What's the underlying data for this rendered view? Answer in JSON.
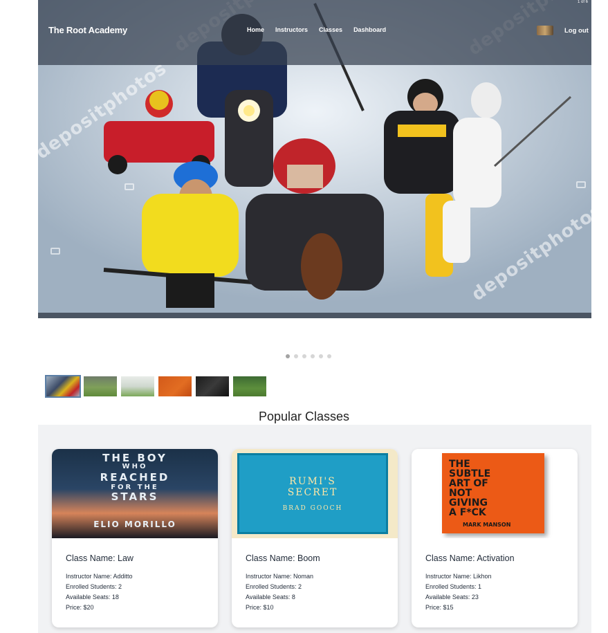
{
  "nav": {
    "brand": "The Root Academy",
    "links": [
      "Home",
      "Instructors",
      "Classes",
      "Dashboard"
    ],
    "logout": "Log out",
    "page_indicator": "1 of 6"
  },
  "hero": {
    "watermarks": [
      "depositphotos",
      "depositphotos",
      "depositphotos",
      "depositphotos"
    ]
  },
  "carousel": {
    "dot_count": 6,
    "active_index": 0,
    "thumbnails": 6
  },
  "section_title": "Popular Classes",
  "classes": [
    {
      "name_label": "Class Name: Law",
      "instructor": "Instructor Name: Additto",
      "enrolled": "Enrolled Students: 2",
      "seats": "Available Seats: 18",
      "price": "Price: $20",
      "cover": {
        "line1": "THE BOY",
        "line2": "WHO",
        "line3": "REACHED",
        "line4": "FOR THE",
        "line5": "STARS",
        "author": "ELIO MORILLO"
      }
    },
    {
      "name_label": "Class Name: Boom",
      "instructor": "Instructor Name: Noman",
      "enrolled": "Enrolled Students: 2",
      "seats": "Available Seats: 8",
      "price": "Price: $10",
      "cover": {
        "line1": "RUMI'S",
        "line2": "SECRET",
        "author": "BRAD GOOCH"
      }
    },
    {
      "name_label": "Class Name: Activation",
      "instructor": "Instructor Name: Likhon",
      "enrolled": "Enrolled Students: 1",
      "seats": "Available Seats: 23",
      "price": "Price: $15",
      "cover": {
        "line1": "THE",
        "line2": "SUBTLE",
        "line3": "ART OF",
        "line4": "NOT",
        "line5": "GIVING",
        "line6": "A F*CK",
        "author": "MARK MANSON"
      }
    }
  ],
  "colors": {
    "navbar": "#374151",
    "section_bg": "#f1f2f4",
    "active_thumb_outline": "#5b7fa6"
  }
}
